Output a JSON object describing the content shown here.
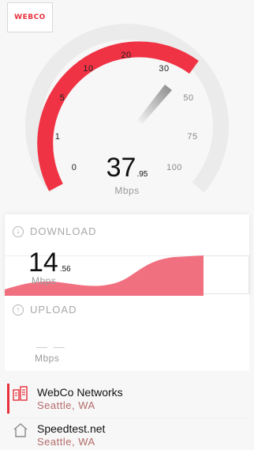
{
  "brand": {
    "logo_text": "WEBCO",
    "accent_color": "#e8303c"
  },
  "gauge": {
    "ticks": [
      "0",
      "1",
      "5",
      "10",
      "20",
      "30",
      "50",
      "75",
      "100"
    ],
    "current_speed_int": "37",
    "current_speed_dec": ".95",
    "unit": "Mbps"
  },
  "download": {
    "label": "DOWNLOAD",
    "icon": "arrow-down-icon",
    "value_int": "14",
    "value_dec": ".56",
    "unit": "Mbps"
  },
  "upload": {
    "label": "UPLOAD",
    "icon": "arrow-up-icon",
    "value": "— —",
    "unit": "Mbps"
  },
  "isp": {
    "name": "WebCo Networks",
    "location": "Seattle, WA",
    "icon": "server-icon"
  },
  "server": {
    "name": "Speedtest.net",
    "location": "Seattle, WA",
    "icon": "home-icon"
  }
}
